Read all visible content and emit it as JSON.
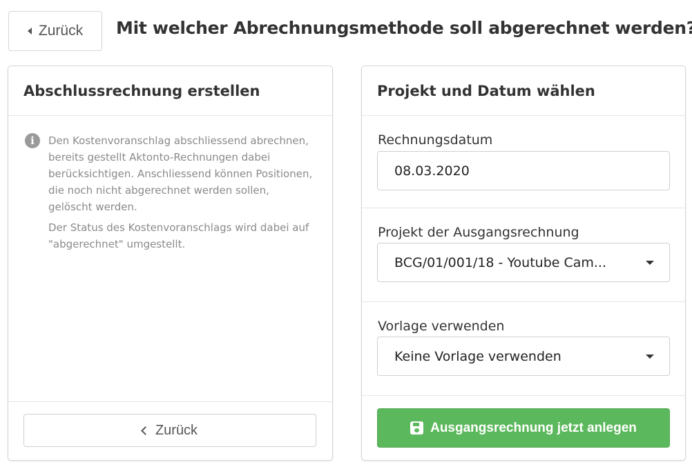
{
  "header": {
    "back_label": "Zurück",
    "title": "Mit welcher Abrechnungsmethode soll abgerechnet werden?"
  },
  "left_card": {
    "title": "Abschlussrechnung erstellen",
    "info_paragraph_1": "Den Kostenvoranschlag abschliessend abrechnen, bereits gestellt Aktonto-Rechnungen dabei berücksichtigen. Anschliessend können Positionen, die noch nicht abgerechnet werden sollen, gelöscht werden.",
    "info_paragraph_2": "Der Status des Kostenvoranschlags wird dabei auf \"abgerechnet\" umgestellt.",
    "back_label": "Zurück"
  },
  "right_card": {
    "title": "Projekt und Datum wählen",
    "date_field": {
      "label": "Rechnungsdatum",
      "value": "08.03.2020"
    },
    "project_field": {
      "label": "Projekt der Ausgangsrechnung",
      "selected": "BCG/01/001/18 - Youtube Cam..."
    },
    "template_field": {
      "label": "Vorlage verwenden",
      "selected": "Keine Vorlage verwenden"
    },
    "submit_label": "Ausgangsrechnung jetzt anlegen"
  },
  "icons": {
    "back": "caret-left-icon",
    "info": "info-circle-icon",
    "chevron": "chevron-left-icon",
    "dropdown": "caret-down-icon",
    "save": "floppy-disk-icon"
  },
  "colors": {
    "primary_green": "#5cb85c",
    "info_icon": "#9a9a9a",
    "muted_text": "#8a8a8a"
  }
}
